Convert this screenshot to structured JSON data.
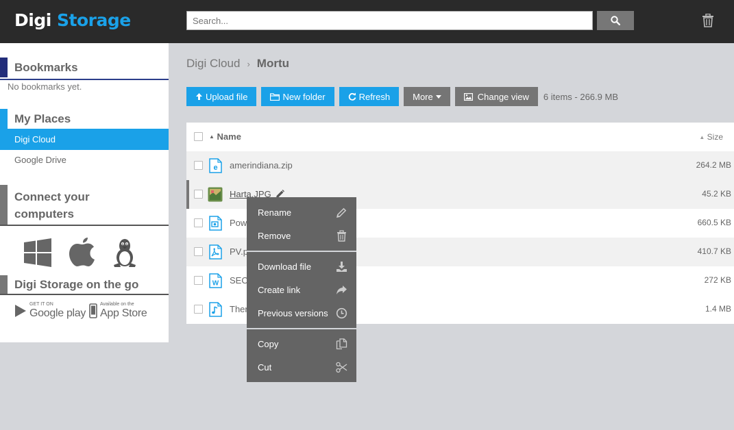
{
  "header": {
    "logo_part1": "Digi",
    "logo_part2": "Storage",
    "search_placeholder": "Search...",
    "icons": [
      "search-icon",
      "trash-icon"
    ]
  },
  "sidebar": {
    "bookmarks_title": "Bookmarks",
    "no_bookmarks": "No bookmarks yet.",
    "places_title": "My Places",
    "places": [
      {
        "label": "Digi Cloud",
        "active": true
      },
      {
        "label": "Google Drive",
        "active": false
      }
    ],
    "connect_title_line1": "Connect your",
    "connect_title_line2": "computers",
    "os_icons": [
      "windows-icon",
      "apple-icon",
      "linux-icon"
    ],
    "go_title": "Digi Storage on the go",
    "google_play_small": "GET IT ON",
    "google_play_big": "Google play",
    "app_store_small": "Available on the",
    "app_store_big": "App Store"
  },
  "breadcrumb": {
    "root": "Digi Cloud",
    "current": "Mortu"
  },
  "toolbar": {
    "upload": "Upload file",
    "new_folder": "New folder",
    "refresh": "Refresh",
    "more": "More",
    "change_view": "Change view",
    "items_info": "6 items - 266.9 MB"
  },
  "table": {
    "col_name": "Name",
    "col_size": "Size",
    "rows": [
      {
        "name": "amerindiana.zip",
        "size": "264.2 MB",
        "icon": "zip-file-icon"
      },
      {
        "name": "Harta.JPG",
        "size": "45.2 KB",
        "icon": "image-file-icon",
        "selected": true
      },
      {
        "name": "Pow",
        "size": "660.5 KB",
        "icon": "powerpoint-file-icon"
      },
      {
        "name": "PV.p",
        "size": "410.7 KB",
        "icon": "pdf-file-icon"
      },
      {
        "name": "SEO",
        "size": "272 KB",
        "icon": "word-file-icon"
      },
      {
        "name": "Ther",
        "size": "1.4 MB",
        "icon": "audio-file-icon"
      }
    ]
  },
  "context_menu": {
    "items": [
      {
        "label": "Rename",
        "icon": "pencil-icon"
      },
      {
        "label": "Remove",
        "icon": "trash-icon"
      },
      {
        "label": "Download file",
        "icon": "download-icon"
      },
      {
        "label": "Create link",
        "icon": "share-icon"
      },
      {
        "label": "Previous versions",
        "icon": "clock-icon"
      },
      {
        "label": "Copy",
        "icon": "copy-icon"
      },
      {
        "label": "Cut",
        "icon": "scissors-icon"
      }
    ]
  },
  "colors": {
    "accent": "#1aa1e8",
    "header_bg": "#2a2a2a",
    "menu_bg": "#646464",
    "bookmarks_bar": "#222d7a"
  }
}
